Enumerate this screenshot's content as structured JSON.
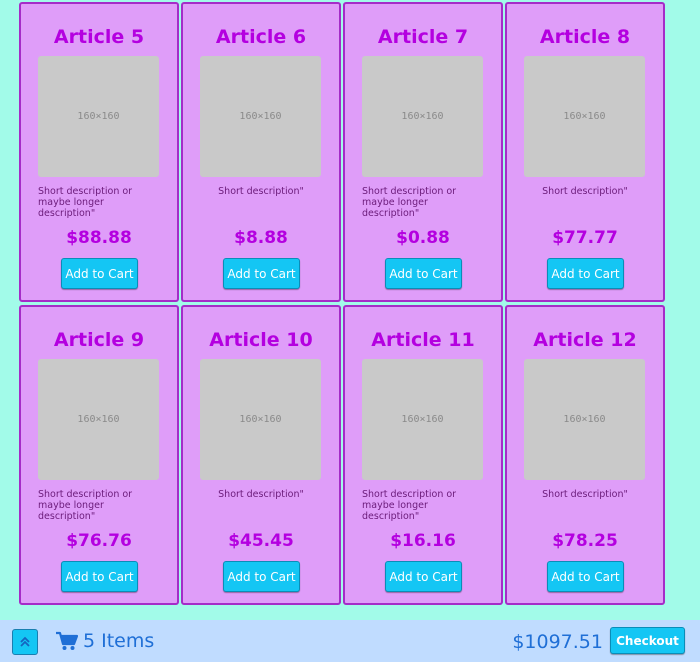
{
  "products": [
    {
      "title": "Article 5",
      "image_text": "160×160",
      "description": "Short description or maybe longer description\"",
      "price": "$88.88",
      "button_label": "Add to Cart"
    },
    {
      "title": "Article 6",
      "image_text": "160×160",
      "description": "Short description\"",
      "price": "$8.88",
      "button_label": "Add to Cart"
    },
    {
      "title": "Article 7",
      "image_text": "160×160",
      "description": "Short description or maybe longer description\"",
      "price": "$0.88",
      "button_label": "Add to Cart"
    },
    {
      "title": "Article 8",
      "image_text": "160×160",
      "description": "Short description\"",
      "price": "$77.77",
      "button_label": "Add to Cart"
    },
    {
      "title": "Article 9",
      "image_text": "160×160",
      "description": "Short description or maybe longer description\"",
      "price": "$76.76",
      "button_label": "Add to Cart"
    },
    {
      "title": "Article 10",
      "image_text": "160×160",
      "description": "Short description\"",
      "price": "$45.45",
      "button_label": "Add to Cart"
    },
    {
      "title": "Article 11",
      "image_text": "160×160",
      "description": "Short description or maybe longer description\"",
      "price": "$16.16",
      "button_label": "Add to Cart"
    },
    {
      "title": "Article 12",
      "image_text": "160×160",
      "description": "Short description\"",
      "price": "$78.25",
      "button_label": "Add to Cart"
    }
  ],
  "footer": {
    "scroll_top_icon": "double-chevron-up-icon",
    "cart_icon": "shopping-cart-icon",
    "items_label": "5 Items",
    "total": "$1097.51",
    "checkout_label": "Checkout"
  },
  "colors": {
    "page_background": "#a2fbe9",
    "card_background": "#df9df9",
    "card_border": "#a52cc8",
    "title_color": "#b400e0",
    "button_background": "#14c6f4",
    "footer_background": "#c0dcff",
    "footer_text": "#1f6fd6"
  }
}
